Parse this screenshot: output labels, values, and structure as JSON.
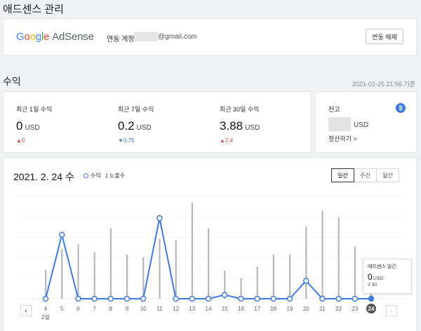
{
  "page": {
    "title": "애드센스 관리"
  },
  "account": {
    "brand": {
      "g1": "G",
      "o1": "o",
      "o2": "o",
      "g2": "g",
      "l": "l",
      "e": "e",
      "product": "AdSense"
    },
    "linked_label": "연동 계정",
    "email_suffix": "@gmail.com",
    "unlink_label": "연동 해제"
  },
  "revenue": {
    "title": "수익",
    "timestamp": "2021-02-25 21:56 기준",
    "metrics": [
      {
        "label": "최근 1일 수익",
        "value": "0",
        "unit": "USD",
        "delta": "0",
        "direction": "up"
      },
      {
        "label": "최근 7일 수익",
        "value": "0.2",
        "unit": "USD",
        "delta": "0.75",
        "direction": "down"
      },
      {
        "label": "최근 30일 수익",
        "value": "3.88",
        "unit": "USD",
        "delta": "2.4",
        "direction": "up"
      }
    ]
  },
  "balance": {
    "label": "잔고",
    "unit": "USD",
    "settle_label": "정산하기 >",
    "icon": "dollar-icon"
  },
  "chart_header": {
    "date": "2021. 2. 24 수",
    "legend_revenue": "수익",
    "legend_impressions": "노출수",
    "tabs": [
      "일간",
      "주간",
      "월간"
    ],
    "active_tab": 0,
    "prev_icon": "chevron-left-icon",
    "next_icon": "chevron-right-icon"
  },
  "tooltip": {
    "title": "애드센스 일간",
    "value": "0",
    "unit": "USD",
    "impressions": "30"
  },
  "colors": {
    "line": "#3f7ae0",
    "bars": "#b3b7bd",
    "up": "#e04b3a",
    "down": "#3d72d9"
  },
  "chart_data": {
    "type": "line",
    "x": [
      "4",
      "5",
      "6",
      "7",
      "8",
      "9",
      "10",
      "11",
      "12",
      "13",
      "14",
      "15",
      "16",
      "17",
      "18",
      "19",
      "20",
      "21",
      "22",
      "23",
      "24"
    ],
    "month_label": "2월",
    "selected_x": "24",
    "series": [
      {
        "name": "수익",
        "type": "line",
        "values": [
          0,
          0.5,
          0,
          0,
          0,
          0,
          0,
          0.63,
          0,
          0,
          0,
          0.03,
          0,
          0,
          0,
          0,
          0.14,
          0,
          0,
          0,
          0
        ]
      },
      {
        "name": "노출수",
        "type": "bar",
        "values": [
          45,
          77,
          85,
          73,
          110,
          69,
          65,
          94,
          91,
          150,
          110,
          44,
          32,
          50,
          69,
          69,
          113,
          138,
          127,
          82,
          30
        ]
      }
    ]
  }
}
